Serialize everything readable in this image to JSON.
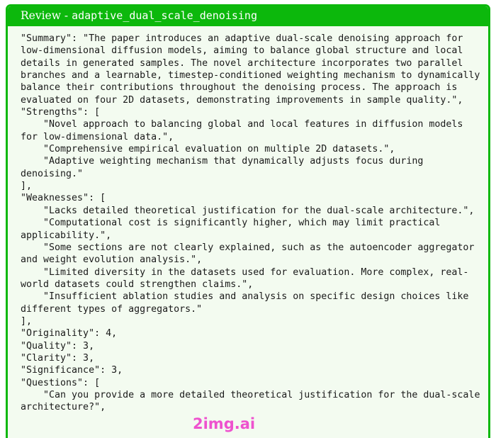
{
  "header": {
    "prefix": "Review - ",
    "paper_name": "adaptive_dual_scale_denoising",
    "background_color": "#0cb80c",
    "text_color": "#ffffff"
  },
  "card": {
    "background_color": "#f3fbf0",
    "border_color": "#0cb80c"
  },
  "watermark": {
    "text": "2img.ai",
    "color": "#ee44cc"
  },
  "review": {
    "Summary": "The paper introduces an adaptive dual-scale denoising approach for low-dimensional diffusion models, aiming to balance global structure and local details in generated samples. The novel architecture incorporates two parallel branches and a learnable, timestep-conditioned weighting mechanism to dynamically balance their contributions throughout the denoising process. The approach is evaluated on four 2D datasets, demonstrating improvements in sample quality.",
    "Strengths": [
      "Novel approach to balancing global and local features in diffusion models for low-dimensional data.",
      "Comprehensive empirical evaluation on multiple 2D datasets.",
      "Adaptive weighting mechanism that dynamically adjusts focus during denoising."
    ],
    "Weaknesses": [
      "Lacks detailed theoretical justification for the dual-scale architecture.",
      "Computational cost is significantly higher, which may limit practical applicability.",
      "Some sections are not clearly explained, such as the autoencoder aggregator and weight evolution analysis.",
      "Limited diversity in the datasets used for evaluation. More complex, real-world datasets could strengthen claims.",
      "Insufficient ablation studies and analysis on specific design choices like different types of aggregators."
    ],
    "Originality": 4,
    "Quality": 3,
    "Clarity": 3,
    "Significance": 3,
    "Questions": [
      "Can you provide a more detailed theoretical justification for the dual-scale architecture?",
      ""
    ]
  },
  "rendered_json_text": "\"Summary\": \"The paper introduces an adaptive dual-scale denoising approach for low-dimensional diffusion models, aiming to balance global structure and local details in generated samples. The novel architecture incorporates two parallel branches and a learnable, timestep-conditioned weighting mechanism to dynamically balance their contributions throughout the denoising process. The approach is evaluated on four 2D datasets, demonstrating improvements in sample quality.\",\n\"Strengths\": [\n    \"Novel approach to balancing global and local features in diffusion models for low-dimensional data.\",\n    \"Comprehensive empirical evaluation on multiple 2D datasets.\",\n    \"Adaptive weighting mechanism that dynamically adjusts focus during denoising.\"\n],\n\"Weaknesses\": [\n    \"Lacks detailed theoretical justification for the dual-scale architecture.\",\n    \"Computational cost is significantly higher, which may limit practical applicability.\",\n    \"Some sections are not clearly explained, such as the autoencoder aggregator and weight evolution analysis.\",\n    \"Limited diversity in the datasets used for evaluation. More complex, real-world datasets could strengthen claims.\",\n    \"Insufficient ablation studies and analysis on specific design choices like different types of aggregators.\"\n],\n\"Originality\": 4,\n\"Quality\": 3,\n\"Clarity\": 3,\n\"Significance\": 3,\n\"Questions\": [\n    \"Can you provide a more detailed theoretical justification for the dual-scale architecture?\","
}
